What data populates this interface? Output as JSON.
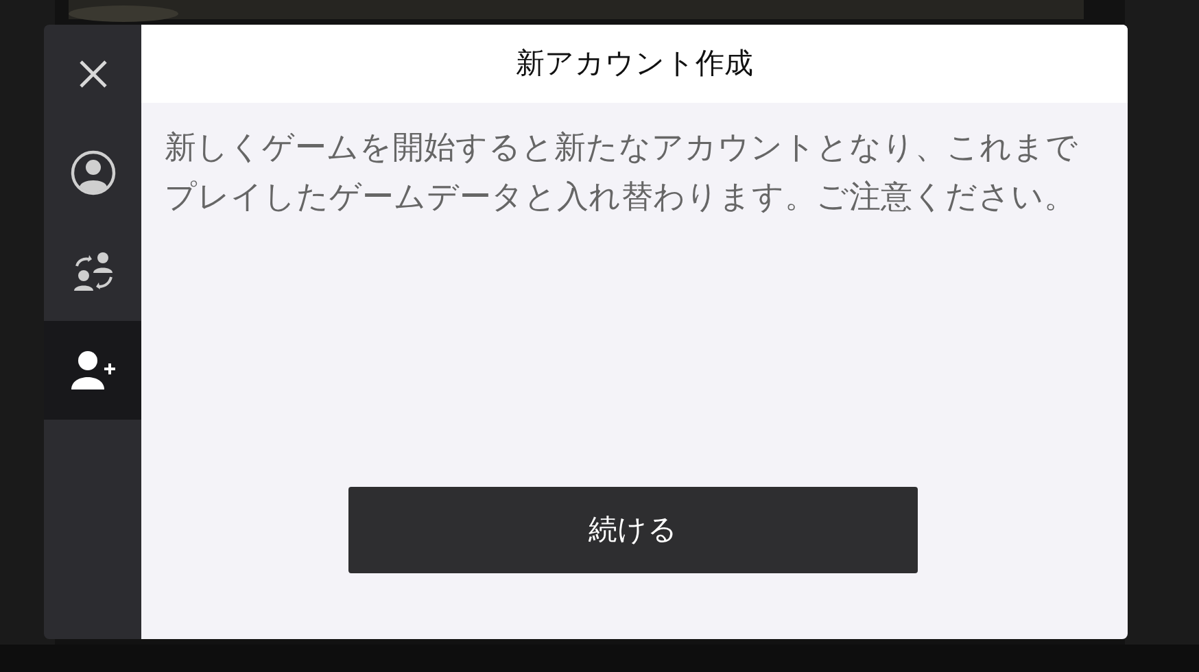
{
  "sidebar": {
    "tabs": [
      {
        "kind": "profile",
        "selected": false
      },
      {
        "kind": "switch",
        "selected": false
      },
      {
        "kind": "add",
        "selected": true
      }
    ]
  },
  "dialog": {
    "title": "新アカウント作成",
    "message": "新しくゲームを開始すると新たなアカウントとなり、これまでプレイしたゲームデータと入れ替わります。ご注意ください。",
    "button": "続ける"
  }
}
